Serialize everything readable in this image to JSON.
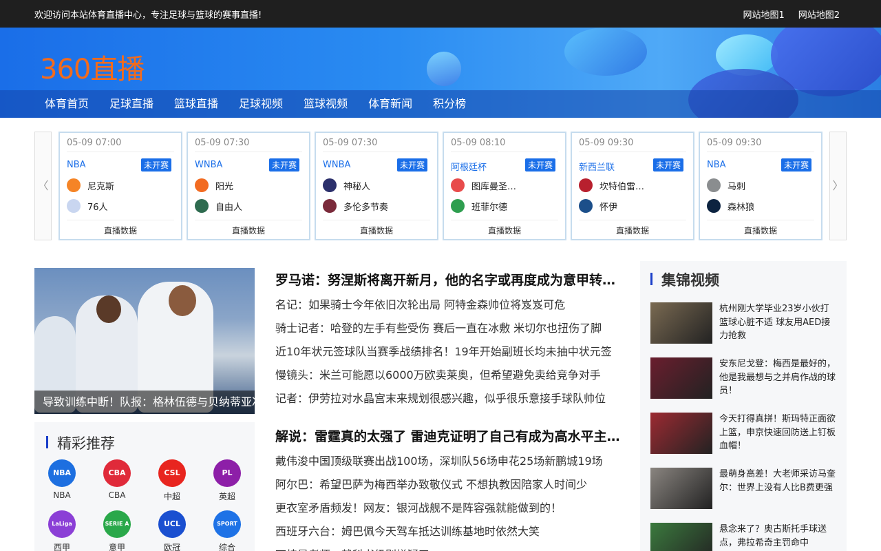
{
  "topbar": {
    "welcome": "欢迎访问本站体育直播中心，专注足球与篮球的赛事直播!",
    "links": [
      "网站地图1",
      "网站地图2"
    ]
  },
  "banner": {
    "logo": "360直播"
  },
  "nav": [
    "体育首页",
    "足球直播",
    "篮球直播",
    "足球视频",
    "篮球视频",
    "体育新闻",
    "积分榜"
  ],
  "matches": {
    "prev_icon": "chevron-left-icon",
    "next_icon": "chevron-right-icon",
    "cards": [
      {
        "time": "05-09 07:00",
        "league": "NBA",
        "status": "未开赛",
        "home": "尼克斯",
        "away": "76人",
        "link": "直播数据",
        "home_color": "#f58426",
        "away_color": "#c9d6f0"
      },
      {
        "time": "05-09 07:30",
        "league": "WNBA",
        "status": "未开赛",
        "home": "阳光",
        "away": "自由人",
        "link": "直播数据",
        "home_color": "#f26b21",
        "away_color": "#2e6b4f"
      },
      {
        "time": "05-09 07:30",
        "league": "WNBA",
        "status": "未开赛",
        "home": "神秘人",
        "away": "多伦多节奏",
        "link": "直播数据",
        "home_color": "#2b2f6b",
        "away_color": "#7a2a3a"
      },
      {
        "time": "05-09 08:10",
        "league": "阿根廷杯",
        "status": "未开赛",
        "home": "图库曼圣…",
        "away": "班菲尔德",
        "link": "直播数据",
        "home_color": "#e84b4b",
        "away_color": "#2e9e4f"
      },
      {
        "time": "05-09 09:30",
        "league": "新西兰联",
        "status": "未开赛",
        "home": "坎特伯雷…",
        "away": "怀伊",
        "link": "直播数据",
        "home_color": "#b8202e",
        "away_color": "#1c4f8a"
      },
      {
        "time": "05-09 09:30",
        "league": "NBA",
        "status": "未开赛",
        "home": "马刺",
        "away": "森林狼",
        "link": "直播数据",
        "home_color": "#8a8d8f",
        "away_color": "#0c2340"
      }
    ]
  },
  "hero": {
    "caption": "导致训练中断！队报：格林伍德与贝纳蒂亚冲突"
  },
  "recommend": {
    "title": "精彩推荐",
    "leagues": [
      {
        "label": "NBA",
        "abbr": "NBA",
        "color": "#1d6fe0"
      },
      {
        "label": "CBA",
        "abbr": "CBA",
        "color": "#e02a3a"
      },
      {
        "label": "中超",
        "abbr": "CSL",
        "color": "#e8251f"
      },
      {
        "label": "英超",
        "abbr": "PL",
        "color": "#8d1fa8"
      },
      {
        "label": "西甲",
        "abbr": "LaLiga",
        "color": "#8b3fd6"
      },
      {
        "label": "意甲",
        "abbr": "SERIE A",
        "color": "#2aa84a"
      },
      {
        "label": "欧冠",
        "abbr": "UCL",
        "color": "#1a4fd0"
      },
      {
        "label": "综合",
        "abbr": "SPORT",
        "color": "#1e72e6"
      }
    ]
  },
  "news": [
    {
      "headline": "罗马诺：努涅斯将离开新月，他的名字或再度成为意甲转会市场焦点",
      "items": [
        "名记：如果骑士今年依旧次轮出局 阿特金森帅位将岌岌可危",
        "骑士记者：哈登的左手有些受伤 赛后一直在冰敷 米切尔也扭伤了脚",
        "近10年状元签球队当赛季战绩排名！19年开始副班长均未抽中状元签",
        "慢镜头：米兰可能愿以6000万欧卖莱奥，但希望避免卖给竞争对手",
        "记者：伊劳拉对水晶宫末来规划很感兴趣，似乎很乐意接手球队帅位"
      ]
    },
    {
      "headline": "解说：雷霆真的太强了 雷迪克证明了自己有成为高水平主帅的能力",
      "items": [
        "戴伟浚中国顶级联赛出战100场，深圳队56场申花25场新鹏城19场",
        "阿尔巴：希望巴萨为梅西举办致敬仪式 不想执教因陪家人时间少",
        "更衣室矛盾频发！网友：银河战舰不是阵容强就能做到的！",
        "西班牙六台：姆巴佩今天驾车抵达训练基地时依然大笑",
        "万炜是老师：赖科书级别嫌疑了"
      ]
    }
  ],
  "videos": {
    "title": "集锦视频",
    "items": [
      {
        "title": "杭州刚大学毕业23岁小伙打篮球心脏不适 球友用AED接力抢救",
        "thumb_color": "#7a6a52"
      },
      {
        "title": "安东尼戈登：梅西是最好的，他是我最想与之并肩作战的球员！",
        "thumb_color": "#6a1e2e"
      },
      {
        "title": "今天打得真拼！斯玛特正面欲上篮，申京快速回防送上钉板血帽！",
        "thumb_color": "#9c2a32"
      },
      {
        "title": "最萌身高差！大老师采访马奎尔：世界上没有人比B费更强",
        "thumb_color": "#8a8580"
      },
      {
        "title": "悬念来了？奥古斯托手球送点，弗拉希奇主罚命中",
        "thumb_color": "#3b7a3e"
      }
    ]
  }
}
